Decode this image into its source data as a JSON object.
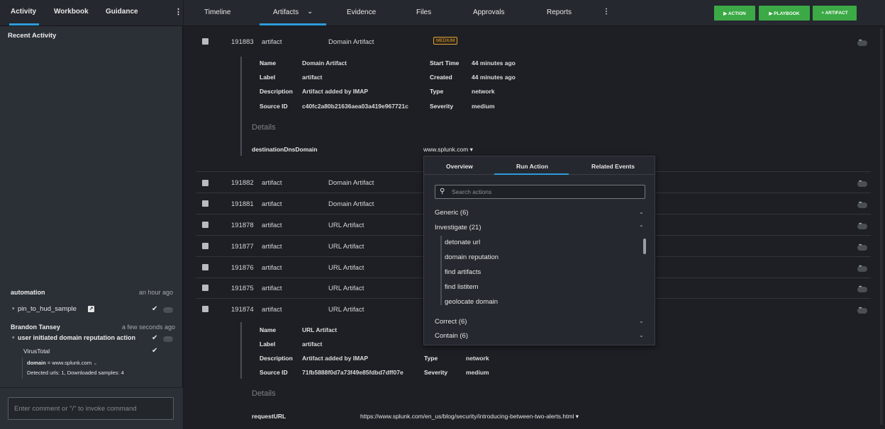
{
  "left_panel": {
    "tabs": [
      "Activity",
      "Workbook",
      "Guidance"
    ],
    "recent_activity": "Recent Activity",
    "automation": {
      "label": "automation",
      "time": "an hour ago"
    },
    "playbook": {
      "label": "pin_to_hud_sample"
    },
    "user": {
      "name": "Brandon Tansey",
      "time": "a few seconds ago"
    },
    "action": {
      "label": "user initiated domain reputation action"
    },
    "app": {
      "label": "VirusTotal"
    },
    "param": {
      "key": "domain",
      "value": "= www.splunk.com"
    },
    "result": "Detected urls: 1, Downloaded samples: 4",
    "comment_placeholder": "Enter comment or \"/\" to invoke command"
  },
  "top_tabs": [
    "Timeline",
    "Artifacts",
    "Evidence",
    "Files",
    "Approvals",
    "Reports"
  ],
  "buttons": {
    "action": "▶ ACTION",
    "playbook": "▶ PLAYBOOK",
    "artifact": "+ ARTIFACT"
  },
  "artifacts": [
    {
      "id": "191883",
      "kind": "artifact",
      "name": "Domain Artifact",
      "severity_badge": "MEDIUM"
    },
    {
      "id": "191882",
      "kind": "artifact",
      "name": "Domain Artifact"
    },
    {
      "id": "191881",
      "kind": "artifact",
      "name": "Domain Artifact"
    },
    {
      "id": "191878",
      "kind": "artifact",
      "name": "URL Artifact"
    },
    {
      "id": "191877",
      "kind": "artifact",
      "name": "URL Artifact"
    },
    {
      "id": "191876",
      "kind": "artifact",
      "name": "URL Artifact"
    },
    {
      "id": "191875",
      "kind": "artifact",
      "name": "URL Artifact"
    },
    {
      "id": "191874",
      "kind": "artifact",
      "name": "URL Artifact"
    }
  ],
  "detail1": {
    "name_k": "Name",
    "name_v": "Domain Artifact",
    "label_k": "Label",
    "label_v": "artifact",
    "desc_k": "Description",
    "desc_v": "Artifact added by IMAP",
    "src_k": "Source ID",
    "src_v": "c40fc2a80b21636aea03a419e967721c",
    "start_k": "Start Time",
    "start_v": "44 minutes ago",
    "created_k": "Created",
    "created_v": "44 minutes ago",
    "type_k": "Type",
    "type_v": "network",
    "sev_k": "Severity",
    "sev_v": "medium",
    "details": "Details",
    "field_k": "destinationDnsDomain",
    "field_v": "www.splunk.com ▾"
  },
  "detail2": {
    "name_k": "Name",
    "name_v": "URL Artifact",
    "label_k": "Label",
    "label_v": "artifact",
    "desc_k": "Description",
    "desc_v": "Artifact added by IMAP",
    "src_k": "Source ID",
    "src_v": "71fb5888f0d7a73f49e85fdbd7dff07e",
    "type_k": "Type",
    "type_v": "network",
    "sev_k": "Severity",
    "sev_v": "medium",
    "details": "Details",
    "field_k": "requestURL",
    "field_v": "https://www.splunk.com/en_us/blog/security/introducing-between-two-alerts.html ▾"
  },
  "popup": {
    "tabs": [
      "Overview",
      "Run Action",
      "Related Events"
    ],
    "search_placeholder": "Search actions",
    "groups": [
      "Generic (6)",
      "Investigate (21)",
      "Correct (6)",
      "Contain (6)"
    ],
    "items": [
      "detonate url",
      "domain reputation",
      "find artifacts",
      "find listitem",
      "geolocate domain"
    ]
  },
  "colors": {
    "accent": "#2d9cdb",
    "green": "#3ba945",
    "medium": "#e0a135"
  }
}
